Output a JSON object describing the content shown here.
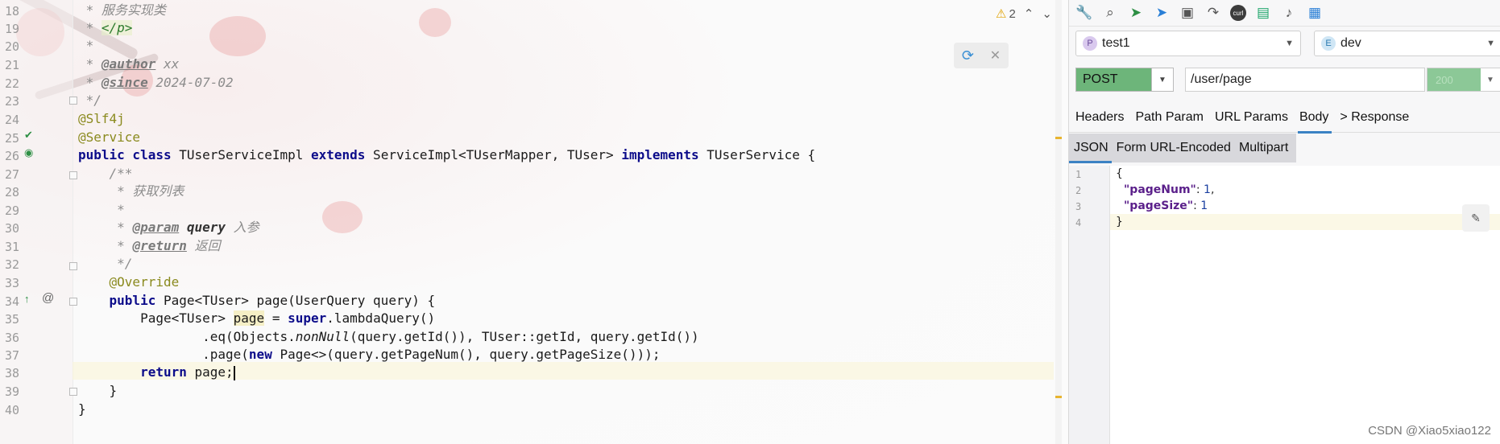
{
  "editor": {
    "line_numbers": [
      "18",
      "19",
      "20",
      "21",
      "22",
      "23",
      "24",
      "25",
      "26",
      "27",
      "28",
      "29",
      "30",
      "31",
      "32",
      "33",
      "34",
      "35",
      "36",
      "37",
      "38",
      "39",
      "40"
    ],
    "lines": {
      "l18": " * 服务实现类",
      "l19_pre": " * ",
      "l19_tag": "</p>",
      "l20": " *",
      "l21_pre": " * ",
      "l21_tag": "@author",
      "l21_post": " xx",
      "l22_pre": " * ",
      "l22_tag": "@since",
      "l22_post": " 2024-07-02",
      "l23": " */",
      "l24": "@Slf4j",
      "l25": "@Service",
      "l26_kw1": "public class",
      "l26_a": " TUserServiceImpl ",
      "l26_kw2": "extends",
      "l26_b": " ServiceImpl<TUserMapper, TUser> ",
      "l26_kw3": "implements",
      "l26_c": " TUserService {",
      "l27": "    /**",
      "l28": "     * 获取列表",
      "l29": "     *",
      "l30_pre": "     * ",
      "l30_tag": "@param",
      "l30_name": " query",
      "l30_post": " 入参",
      "l31_pre": "     * ",
      "l31_tag": "@return",
      "l31_post": " 返回",
      "l32": "     */",
      "l33": "    @Override",
      "l34_kw": "public",
      "l34_a": " Page<TUser> page(UserQuery query) {",
      "l35_a": "        Page<TUser> ",
      "l35_var": "page",
      "l35_b": " = ",
      "l35_kw": "super",
      "l35_c": ".lambdaQuery()",
      "l36_a": "                .eq(Objects.",
      "l36_it": "nonNull",
      "l36_b": "(query.getId()), TUser::getId, query.getId())",
      "l37_a": "                .page(",
      "l37_kw": "new",
      "l37_b": " Page<>(query.getPageNum(), query.getPageSize()));",
      "l38_kw": "        return",
      "l38_a": " page;",
      "l39": "    }",
      "l40": "}"
    },
    "warning_count": "2",
    "warning_icon": "warning-triangle-icon"
  },
  "panel": {
    "toolbar_icons": [
      "wrench-icon",
      "search-icon",
      "send-green-icon",
      "send-blue-icon",
      "save-icon",
      "redo-icon",
      "curl-icon",
      "book-icon",
      "bell-icon",
      "gift-icon"
    ],
    "curl_label": "curl",
    "project": {
      "badge": "P",
      "name": "test1"
    },
    "env": {
      "badge": "E",
      "name": "dev"
    },
    "method": "POST",
    "url": "/user/page",
    "status": "200",
    "tabs": [
      "Headers",
      "Path Param",
      "URL Params",
      "Body",
      "> Response"
    ],
    "active_tab": "Body",
    "subtabs": [
      "JSON",
      "Form URL-Encoded",
      "Multipart"
    ],
    "json_lines": {
      "n1": "1",
      "n2": "2",
      "n3": "3",
      "n4": "4",
      "open": "{",
      "k1": "\"pageNum\"",
      "v1": "1",
      "k2": "\"pageSize\"",
      "v2": "1",
      "close": "}"
    }
  },
  "watermark": "CSDN @Xiao5xiao122"
}
